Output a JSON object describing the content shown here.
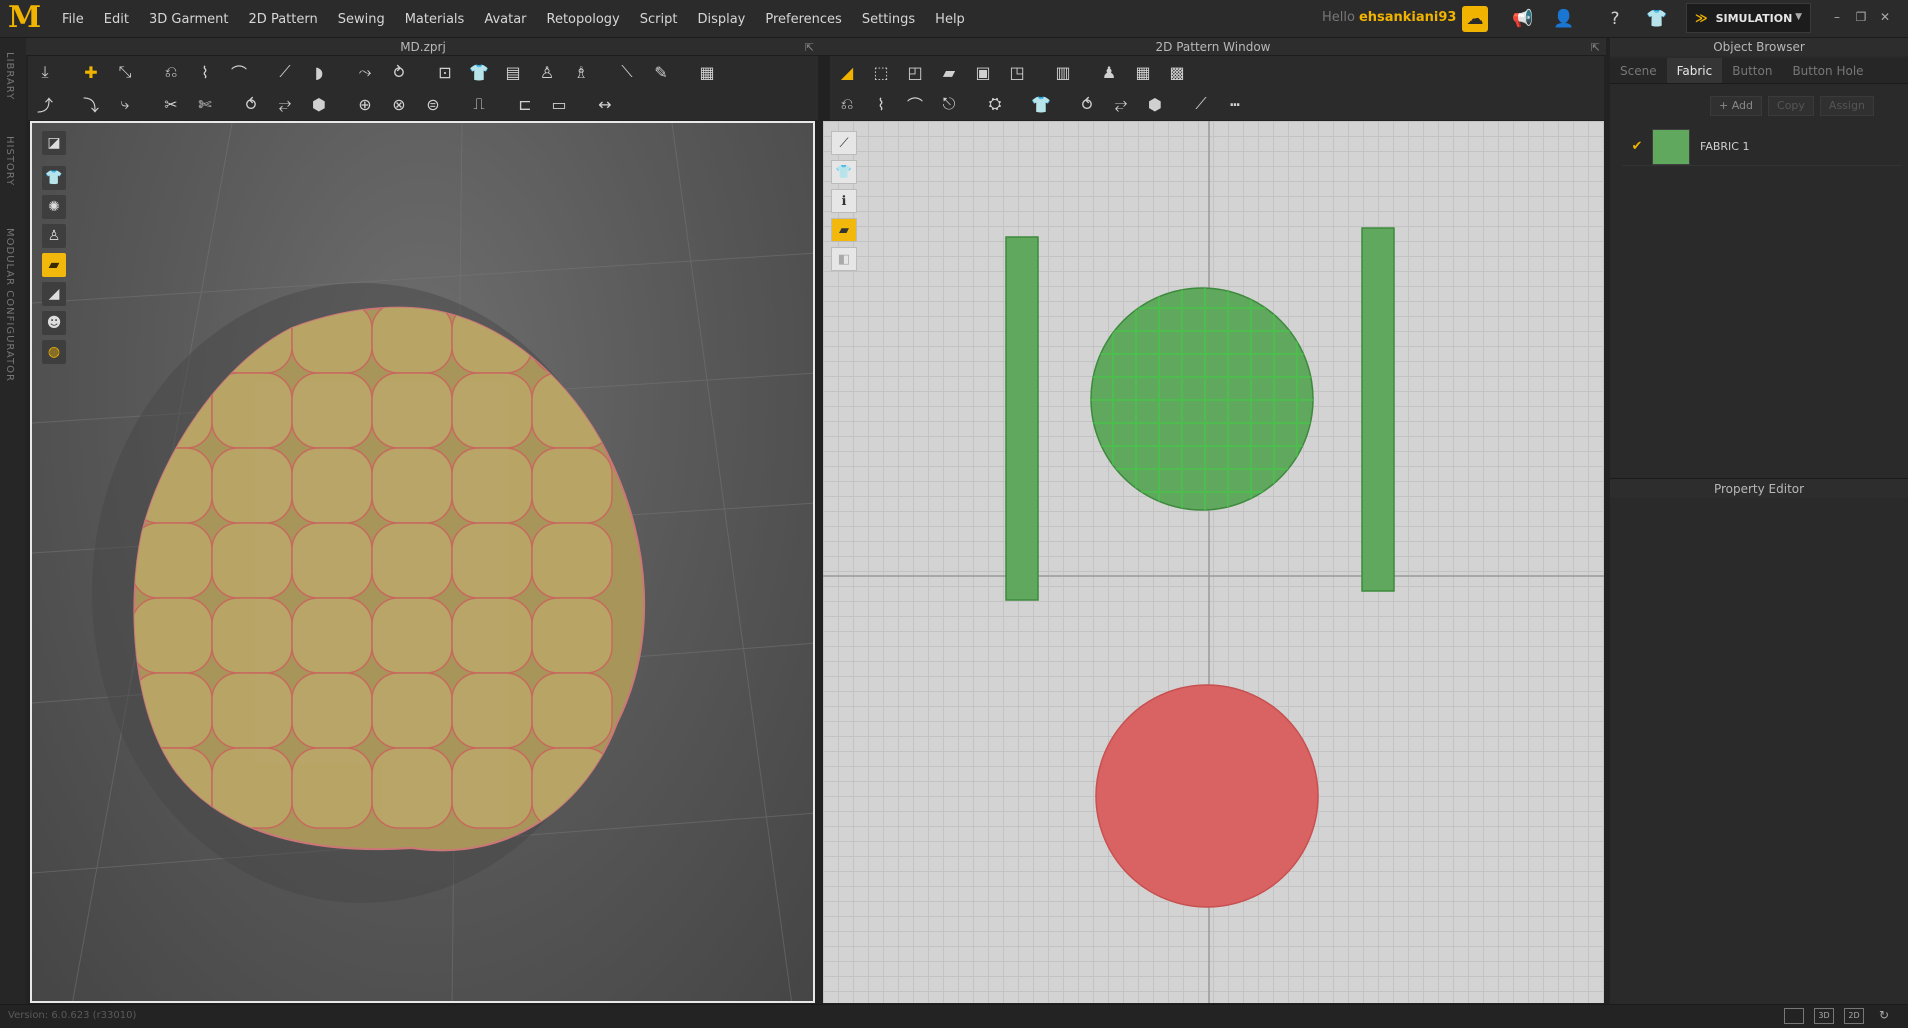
{
  "app": {
    "logo": "M",
    "menu": [
      "File",
      "Edit",
      "3D Garment",
      "2D Pattern",
      "Sewing",
      "Materials",
      "Avatar",
      "Retopology",
      "Script",
      "Display",
      "Preferences",
      "Settings",
      "Help"
    ],
    "greeting": "Hello",
    "username": "ehsankiani93",
    "mode": "SIMULATION"
  },
  "side_tabs": [
    "LIBRARY",
    "HISTORY",
    "MODULAR CONFIGURATOR"
  ],
  "viewport3d": {
    "title": "MD.zprj"
  },
  "pattern_window": {
    "title": "2D Pattern Window"
  },
  "object_browser": {
    "title": "Object Browser",
    "tabs": [
      "Scene",
      "Fabric",
      "Button",
      "Button Hole"
    ],
    "active_tab": "Fabric",
    "actions": {
      "add": "+ Add",
      "copy": "Copy",
      "assign": "Assign"
    },
    "fabrics": [
      {
        "name": "FABRIC 1",
        "color": "#5fa85e",
        "checked": true
      }
    ]
  },
  "property_editor": {
    "title": "Property Editor"
  },
  "status": {
    "version": "Version: 6.0.623 (r33010)",
    "view_modes": [
      "",
      "3D",
      "2D"
    ]
  },
  "colors": {
    "accent": "#f0b400",
    "pattern_green": "#5fa85e",
    "pattern_red": "#d96262",
    "garment_tan": "#b09a5a"
  }
}
